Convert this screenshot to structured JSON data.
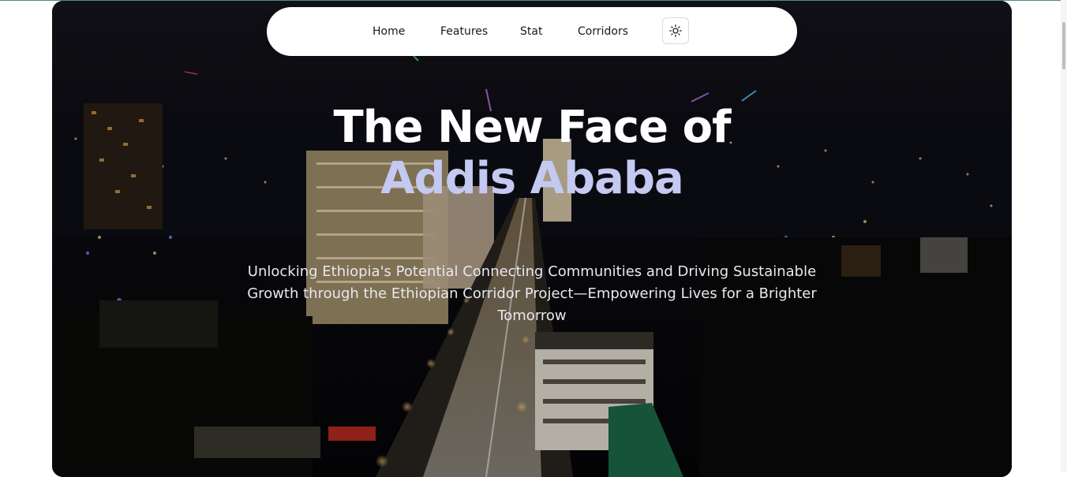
{
  "nav": {
    "items": [
      {
        "label": "Home"
      },
      {
        "label": "Features"
      },
      {
        "label": "Stat"
      },
      {
        "label": "Corridors"
      }
    ],
    "theme_toggle_icon": "sun-icon"
  },
  "hero": {
    "title_line1": "The New Face of",
    "title_line2": "Addis Ababa",
    "subtitle": "Unlocking Ethiopia's Potential Connecting Communities and Driving Sustainable Growth through the Ethiopian Corridor Project—Empowering Lives for a Brighter Tomorrow",
    "colors": {
      "title": "#ffffff",
      "title_accent": "#c4c9f2",
      "background": "#07070d"
    }
  }
}
